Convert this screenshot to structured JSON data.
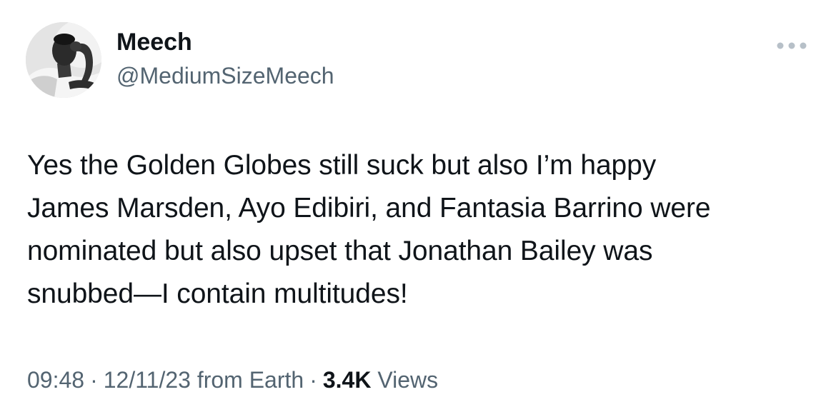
{
  "author": {
    "display_name": "Meech",
    "handle": "@MediumSizeMeech",
    "avatar_icon": "profile-photo"
  },
  "more_icon": "ellipsis-icon",
  "tweet": {
    "text": "Yes the Golden Globes still suck but also I’m happy\nJames Marsden, Ayo Edibiri, and Fantasia Barrino were\nnominated but also upset that Jonathan Bailey was\nsnubbed—I contain multitudes!"
  },
  "meta": {
    "time": "09:48",
    "separator": "·",
    "date": "12/11/23",
    "source": "from Earth",
    "views_count": "3.4K",
    "views_label": "Views"
  },
  "colors": {
    "text_primary": "#0f1419",
    "text_secondary": "#536471",
    "background": "#ffffff"
  }
}
